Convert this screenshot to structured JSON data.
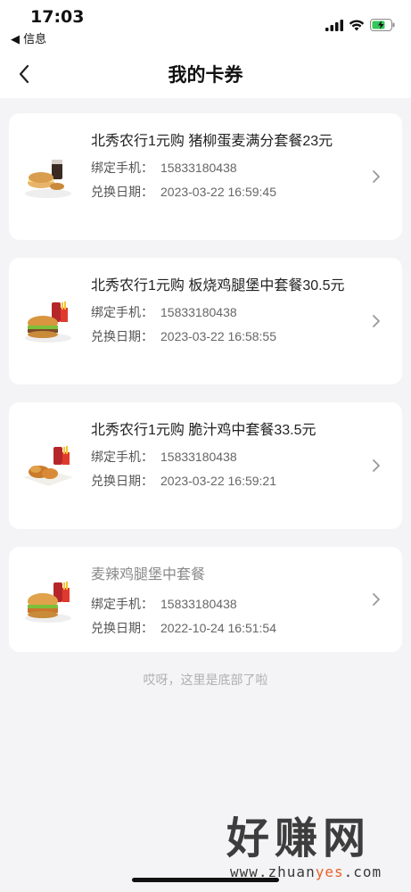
{
  "status": {
    "time": "17:03",
    "back_label": "◀ 信息",
    "battery_color": "#34c759"
  },
  "header": {
    "title": "我的卡券"
  },
  "cards": [
    {
      "title": "北秀农行1元购 猪柳蛋麦满分套餐23元",
      "phone_label": "绑定手机：",
      "phone": "15833180438",
      "date_label": "兑换日期：",
      "date": "2023-03-22 16:59:45",
      "thumb_icon": "breakfast-meal-icon",
      "expired": false
    },
    {
      "title": "北秀农行1元购 板烧鸡腿堡中套餐30.5元",
      "phone_label": "绑定手机：",
      "phone": "15833180438",
      "date_label": "兑换日期：",
      "date": "2023-03-22 16:58:55",
      "thumb_icon": "burger-meal-icon",
      "expired": false
    },
    {
      "title": "北秀农行1元购 脆汁鸡中套餐33.5元",
      "phone_label": "绑定手机：",
      "phone": "15833180438",
      "date_label": "兑换日期：",
      "date": "2023-03-22 16:59:21",
      "thumb_icon": "fried-chicken-meal-icon",
      "expired": false
    },
    {
      "title": "麦辣鸡腿堡中套餐",
      "phone_label": "绑定手机：",
      "phone": "15833180438",
      "date_label": "兑换日期：",
      "date": "2022-10-24 16:51:54",
      "thumb_icon": "spicy-burger-meal-icon",
      "expired": true
    }
  ],
  "footer": {
    "end_note": "哎呀，这里是底部了啦"
  },
  "watermark": {
    "big": "好赚网",
    "small_a": "www.zhuan",
    "small_hl": "yes",
    "small_b": ".com",
    "accent_color": "#e8632a"
  }
}
